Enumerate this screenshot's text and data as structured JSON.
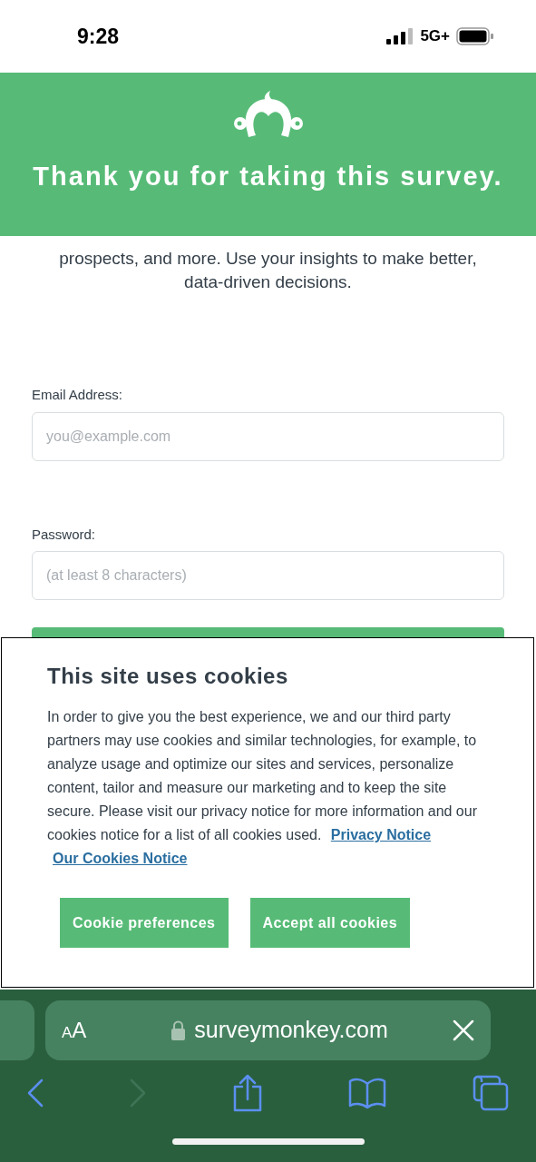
{
  "status_bar": {
    "time": "9:28",
    "network": "5G+"
  },
  "banner": {
    "title": "Thank you for taking this survey."
  },
  "intro": {
    "text": "prospects, and more. Use your insights to make better, data-driven decisions."
  },
  "form": {
    "fields": [
      {
        "label": "Email Address:",
        "placeholder": "you@example.com"
      },
      {
        "label": "Password:",
        "placeholder": "(at least 8 characters)"
      }
    ]
  },
  "cookie_banner": {
    "title": "This site uses cookies",
    "body": "In order to give you the best experience, we and our third party partners may use cookies and similar technologies, for example, to analyze usage and optimize our sites and services, personalize content, tailor and measure our marketing and to keep the site secure. Please visit our privacy notice for more information and our cookies notice for a list of all cookies used.",
    "links": [
      "Privacy Notice",
      "Our Cookies Notice"
    ],
    "buttons": [
      "Cookie preferences",
      "Accept all cookies"
    ]
  },
  "browser": {
    "text_size_label": "AA",
    "url": "surveymonkey.com",
    "forward_disabled": true
  }
}
